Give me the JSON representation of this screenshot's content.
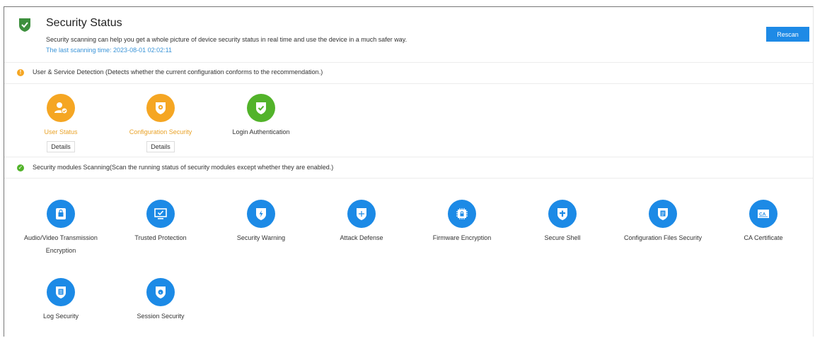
{
  "header": {
    "title": "Security Status",
    "description": "Security scanning can help you get a whole picture of device security status in real time and use the device in a much safer way.",
    "last_scan": "The last scanning time: 2023-08-01 02:02:11",
    "rescan_label": "Rescan"
  },
  "user_service": {
    "title": "User & Service Detection (Detects whether the current configuration conforms to the recommendation.)",
    "status_color": "#f5a623",
    "items": [
      {
        "label": "User Status",
        "state": "warning",
        "icon": "user-check-icon",
        "details_label": "Details"
      },
      {
        "label": "Configuration Security",
        "state": "warning",
        "icon": "gear-shield-icon",
        "details_label": "Details"
      },
      {
        "label": "Login Authentication",
        "state": "ok",
        "icon": "check-shield-icon"
      }
    ]
  },
  "modules": {
    "title": "Security modules Scanning(Scan the running status of security modules except whether they are enabled.)",
    "status_color": "#52b32a",
    "items": [
      {
        "label": "Audio/Video Transmission\nEncryption",
        "icon": "av-lock-icon"
      },
      {
        "label": "Trusted Protection",
        "icon": "monitor-check-icon"
      },
      {
        "label": "Security Warning",
        "icon": "lightning-shield-icon"
      },
      {
        "label": "Attack Defense",
        "icon": "plus-shield-icon"
      },
      {
        "label": "Firmware Encryption",
        "icon": "chip-lock-icon"
      },
      {
        "label": "Secure Shell",
        "icon": "cross-shield-icon"
      },
      {
        "label": "Configuration Files Security",
        "icon": "file-shield-icon"
      },
      {
        "label": "CA Certificate",
        "icon": "ca-certificate-icon"
      },
      {
        "label": "Log Security",
        "icon": "log-shield-icon"
      },
      {
        "label": "Session Security",
        "icon": "session-shield-icon"
      }
    ]
  },
  "colors": {
    "accent": "#1e8ae6",
    "warning": "#f5a623",
    "ok": "#52b32a",
    "link": "#3a94d8"
  }
}
